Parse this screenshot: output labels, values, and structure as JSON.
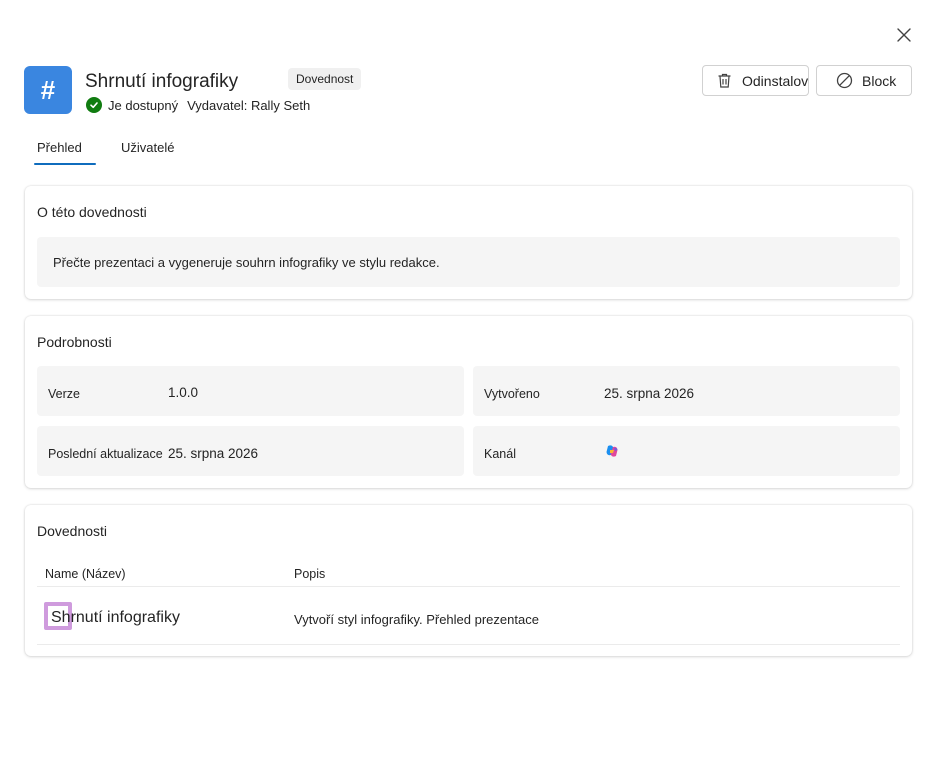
{
  "header": {
    "app_icon_glyph": "#",
    "app_icon_color": "#3a86e0",
    "title": "Shrnutí infografiky",
    "type_badge": "Dovednost",
    "status": "Je dostupný",
    "publisher": "Vydavatel: Rally Seth"
  },
  "actions": {
    "uninstall_label": "Odinstalovat",
    "block_label": "Block"
  },
  "tabs": [
    {
      "label": "Přehled",
      "active": true
    },
    {
      "label": "Uživatelé",
      "active": false
    }
  ],
  "about": {
    "title": "O této dovednosti",
    "description": "Přečte prezentaci a vygeneruje souhrn infografiky ve stylu redakce."
  },
  "details": {
    "title": "Podrobnosti",
    "version_label": "Verze",
    "version_value": "1.0.0",
    "created_label": "Vytvořeno",
    "created_value": "25. srpna 2026",
    "updated_label": "Poslední aktualizace",
    "updated_value": "25. srpna 2026",
    "channel_label": "Kanál",
    "channel_icon": "copilot-icon"
  },
  "skills": {
    "title": "Dovednosti",
    "columns": [
      "Name (Název)",
      "Popis"
    ],
    "rows": [
      {
        "name": "Shrnutí infografiky",
        "description": "Vytvoří styl infografiky. Přehled prezentace"
      }
    ]
  },
  "colors": {
    "accent": "#0f6cbd",
    "status_ok": "#107c10"
  }
}
